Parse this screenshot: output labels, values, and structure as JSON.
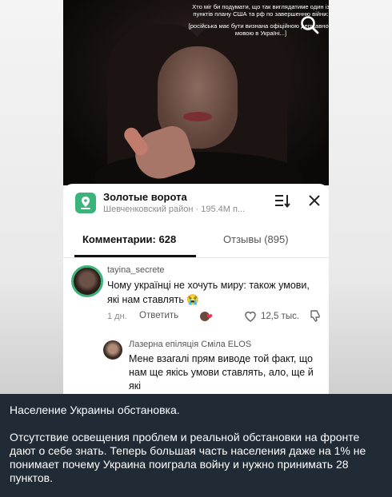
{
  "video": {
    "overlay_line1": "Хто міг би подумати, що так виглядатиме один із пунктів плану США та рф по завершенню війни:",
    "overlay_line2": "[російська має бути визнана офіційною державною мовою в Україні...]",
    "search_icon": "search-icon"
  },
  "location": {
    "title": "Золотые ворота",
    "subtitle": "Шевченковский район · 195.4М п...",
    "icon": "map-pin-icon",
    "accent_color": "#3bb37a"
  },
  "tabs": {
    "comments": "Комментарии: 628",
    "reviews": "Отзывы (895)"
  },
  "comment1": {
    "user": "tayina_secrete",
    "text": "Чому українці не хочуть миру: також умови, які нам ставлять 😭",
    "time": "1 дн.",
    "reply": "Ответить",
    "likes": "12,5 тыс."
  },
  "comment2": {
    "user": "Лазерна епіляція Сміла ELOS",
    "text": "Мене взагалі прям виводе той факт, що нам ще якісь умови ставлять, ало, ще й які"
  },
  "caption": {
    "title": "Население Украины обстановка.",
    "body": "Отсутствие освещения проблем и реальной обстановки на фронте дают о себе знать. Теперь большая часть населения даже на 1% не понимает почему Украина поиграла войну и нужно принимать 28 пунктов.",
    "background": "#202b36"
  }
}
